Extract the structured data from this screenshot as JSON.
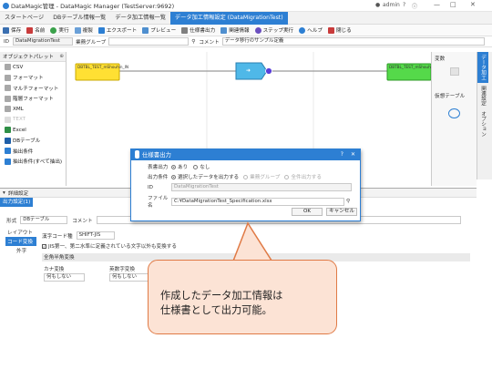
{
  "window": {
    "title": "DataMagic管理 - DataMagic Manager (TestServer:9692)",
    "user": "admin"
  },
  "menu": {
    "items": [
      "スタートページ",
      "DBテーブル情報一覧",
      "データ加工情報一覧",
      "データ加工情報設定 (DataMigrationTest)"
    ],
    "active": 3
  },
  "toolbar": {
    "items": [
      "保存",
      "名前",
      "実行",
      "複製",
      "エクスポート",
      "プレビュー",
      "仕様書出力",
      "関連情報",
      "ステップ実行",
      "ヘルプ",
      "閉じる"
    ]
  },
  "idbar": {
    "id_label": "ID",
    "id_value": "DataMigrationTest",
    "group_label": "業務グループ",
    "comment_label": "コメント",
    "comment_value": "データ移行のサンプル定義"
  },
  "palette": {
    "title": "オブジェクトパレット",
    "items": [
      "CSV",
      "フォーマット",
      "マルチフォーマット",
      "階層フォーマット",
      "XML",
      "TEXT",
      "Excel",
      "DBテーブル",
      "抽出条件",
      "抽出条件(すべて抽出)"
    ]
  },
  "canvas": {
    "node_in": "DBTBL_TEST_mShouhin_IN",
    "node_out": "DBTBL_TEST_mShouhin_OUT"
  },
  "rightpanel": {
    "var_label": "変数",
    "vtable_label": "仮想テーブル"
  },
  "sidetabs": [
    "データ加工",
    "関連設定",
    "オプション"
  ],
  "bottom": {
    "header": "詳細設定",
    "output_tab": "出力設定(1)",
    "format_label": "形式",
    "format_value": "DBテーブル",
    "comment_label": "コメント",
    "layout_tab": "レイアウト",
    "code_tab": "コード変換",
    "external_tab": "外字",
    "charset_label": "漢字コード種",
    "charset_value": "SHIFT-JIS",
    "checkbox_label": "JIS第一、第二水準に定義されている文字以外も変換する",
    "fullhalf_header": "全角半角変換",
    "kana_label": "カナ変換",
    "kana_value": "何もしない",
    "alnum_label": "英数字変換",
    "alnum_value": "何もしない"
  },
  "dialog": {
    "title": "仕様書出力",
    "header_label": "表書出力",
    "header_yes": "あり",
    "header_no": "なし",
    "cond_label": "出力条件",
    "cond_selected": "選択したデータを出力する",
    "cond_group": "業務グループ",
    "cond_all": "全件出力する",
    "id_label": "ID",
    "id_value": "DataMigrationTest",
    "file_label": "ファイル名",
    "file_value": "C:¥DataMigrationTest_Specification.xlsx",
    "ok_label": "OK",
    "cancel_label": "キャンセル"
  },
  "callout": {
    "line1": "作成したデータ加工情報は",
    "line2": "仕様書として出力可能。"
  },
  "colors": {
    "accent": "#2d7fd3",
    "callout_bg": "#fce3d5",
    "callout_border": "#e07a45",
    "node_in": "#ffe033",
    "node_out": "#55d94a",
    "node_mid": "#4fb8e8"
  }
}
